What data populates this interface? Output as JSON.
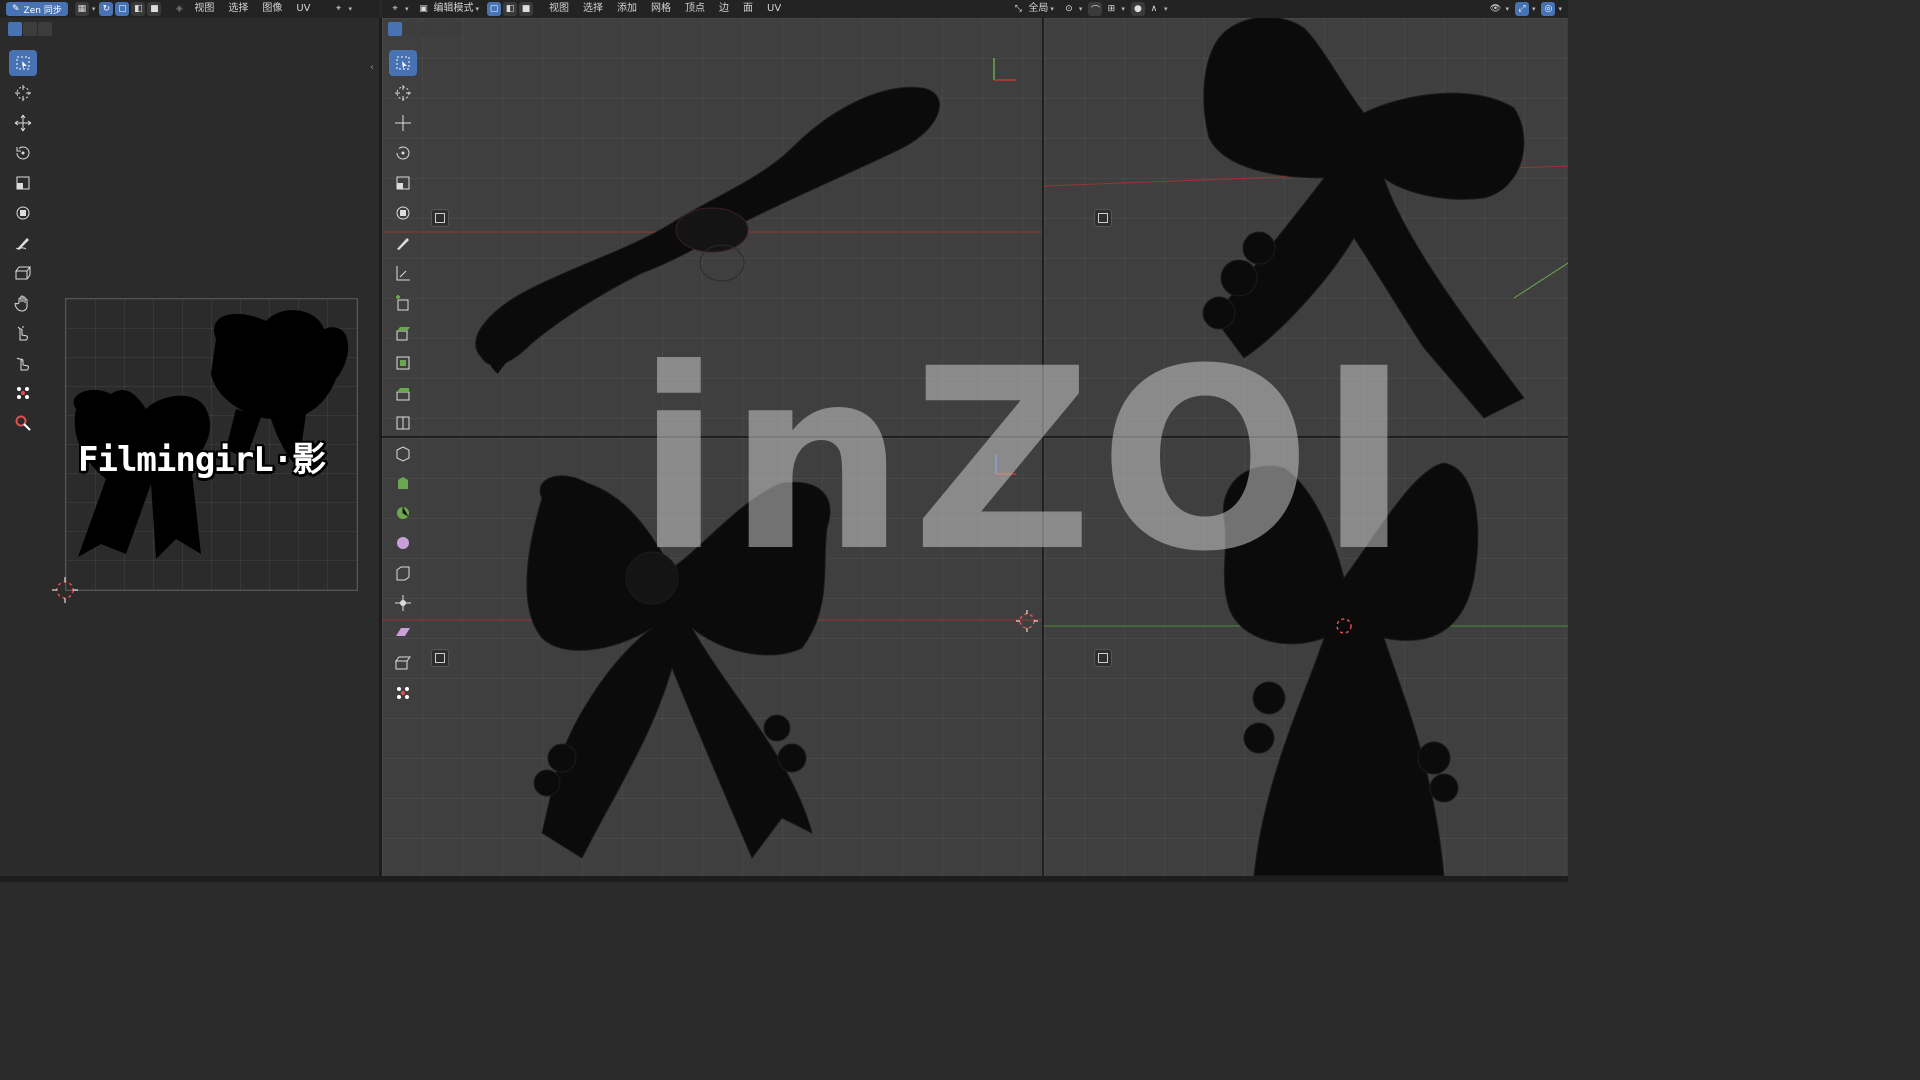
{
  "uv_editor": {
    "sync_button": "Zen 同步",
    "menu": [
      "视图",
      "选择",
      "图像",
      "UV"
    ],
    "brand_text": "FilmingirL·影"
  },
  "viewport_header": {
    "mode_label": "编辑模式",
    "menu": [
      "视图",
      "选择",
      "添加",
      "网格",
      "顶点",
      "边",
      "面",
      "UV"
    ],
    "pivot_label": "全局"
  },
  "watermark": "inZOI",
  "icons": {
    "uv_tools": [
      "select-box-icon",
      "cursor-icon",
      "move-icon",
      "rotate-icon",
      "scale-icon",
      "transform-icon",
      "annotate-icon",
      "rip-icon",
      "grab-icon",
      "relax-icon",
      "pinch-icon",
      "sculpt-icon",
      "zoom-icon"
    ],
    "mesh_tools": [
      "select-box-icon",
      "cursor-icon",
      "move-icon",
      "rotate-icon",
      "scale-icon",
      "transform-icon",
      "annotate-icon",
      "measure-icon",
      "add-cube-icon",
      "extrude-icon",
      "inset-icon",
      "bevel-icon",
      "loop-cut-icon",
      "knife-icon",
      "poly-build-icon",
      "spin-icon",
      "smooth-icon",
      "edge-slide-icon",
      "shrink-fatten-icon",
      "shear-icon",
      "rip-region-icon",
      "vertex-icon"
    ]
  },
  "colors": {
    "accent": "#4772b3",
    "x_axis": "#c0392b",
    "y_axis": "#6aa84f",
    "z_axis": "#3b6fd8",
    "mesh": "#0d0d0d",
    "background": "#3f3f3f"
  }
}
